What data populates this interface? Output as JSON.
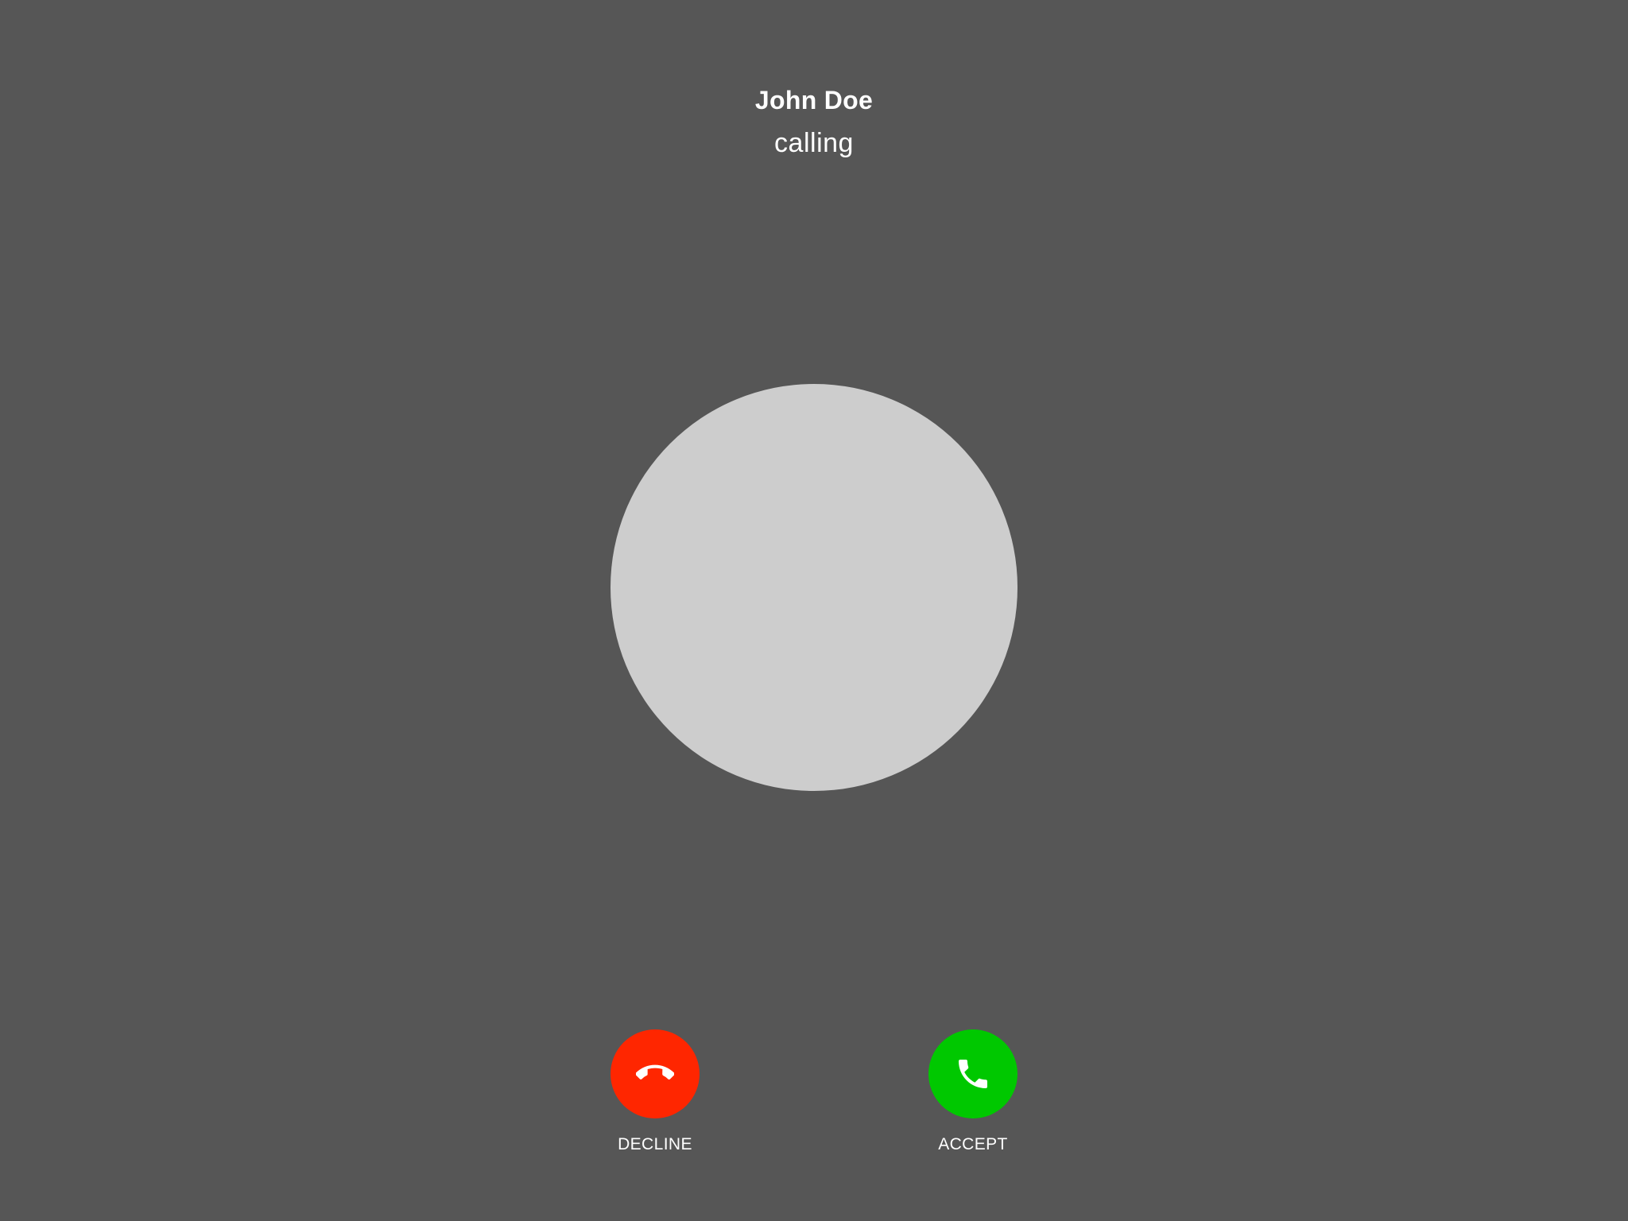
{
  "caller": {
    "name": "John Doe",
    "status": "calling"
  },
  "actions": {
    "decline": {
      "label": "DECLINE",
      "icon": "phone-hangup-icon",
      "color": "#ff2600"
    },
    "accept": {
      "label": "ACCEPT",
      "icon": "phone-icon",
      "color": "#00c800"
    }
  },
  "colors": {
    "background": "#565656",
    "avatar_placeholder": "#cdcdcd",
    "text": "#ffffff"
  }
}
